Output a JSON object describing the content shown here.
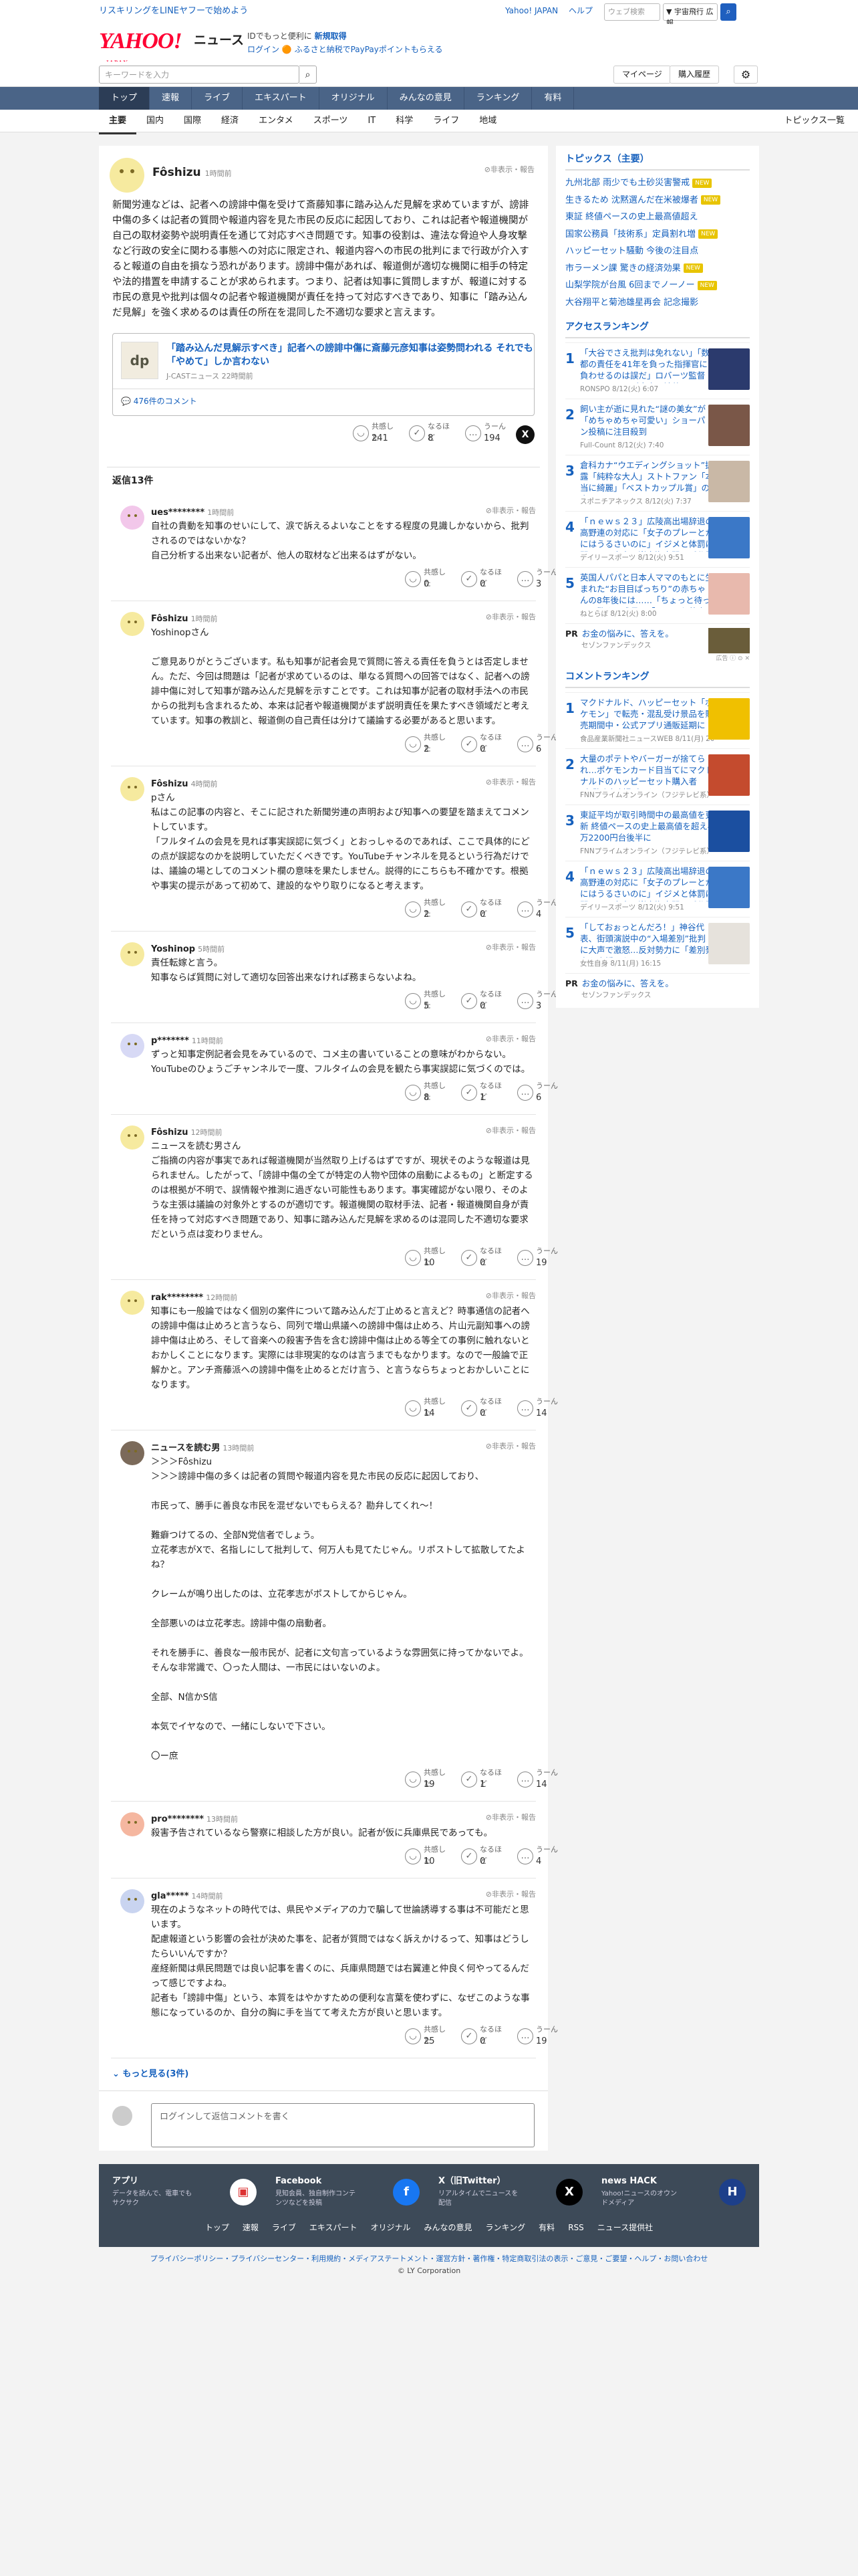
{
  "topbar": {
    "promo": "リスキリングをLINEヤフーで始めよう",
    "links": [
      "Yahoo! JAPAN",
      "ヘルプ"
    ],
    "search_placeholder": "ウェブ検索",
    "select": "▼ 宇宙飛行 広報",
    "search_icon": "search-icon"
  },
  "header": {
    "logo": "YAHOO!",
    "logo_small": "JAPAN",
    "section": "ニュース",
    "promo1_pre": "IDでもっと便利に",
    "promo1_link": "新規取得",
    "promo2": "ログイン 🟠 ふるさと納税でPayPayポイントもらえる"
  },
  "search": {
    "placeholder": "キーワードを入力",
    "mypage": "マイページ",
    "buy": "購入履歴"
  },
  "nav": {
    "tabs": [
      "トップ",
      "速報",
      "ライブ",
      "エキスパート",
      "オリジナル",
      "みんなの意見",
      "ランキング",
      "有料"
    ]
  },
  "categories": {
    "items": [
      "主要",
      "国内",
      "国際",
      "経済",
      "エンタメ",
      "スポーツ",
      "IT",
      "科学",
      "ライフ",
      "地域"
    ],
    "topics_link": "トピックス一覧"
  },
  "post": {
    "name": "Fôshizu",
    "time": "1時間前",
    "report": "非表示・報告",
    "body": "新聞労連などは、記者への謗誹中傷を受けて斎藤知事に踏み込んだ見解を求めていますが、謗誹中傷の多くは記者の質問や報道内容を見た市民の反応に起因しており、これは記者や報道機関が自己の取材姿勢や説明責任を通じて対応すべき問題です。知事の役割は、違法な脅迫や人身攻撃など行政の安全に関わる事態への対応に限定され、報道内容への市民の批判にまで行政が介入すると報道の自由を損なう恐れがあります。謗誹中傷があれば、報道側が適切な機関に相手の特定や法的措置を申請することが求められます。つまり、記者は知事に質問しますが、報道に対する市民の意見や批判は個々の記者や報道機関が責任を持って対応すべきであり、知事に「踏み込んだ見解」を強く求めるのは責任の所在を混同した不適切な要求と言えます。",
    "card": {
      "thumb": "dp",
      "title": "「踏み込んだ見解示すべき」記者への謗誹中傷に斎藤元彦知事は姿勢問われる それでも「やめて」しか言わない",
      "source": "J-CASTニュース 22時間前",
      "comments": "476件のコメント"
    },
    "reactions": [
      {
        "label": "共感した",
        "count": "241"
      },
      {
        "label": "なるほど",
        "count": "8"
      },
      {
        "label": "うーん",
        "count": "194"
      }
    ]
  },
  "reply_header": "返信13件",
  "comments": [
    {
      "name": "ues********",
      "time": "1時間前",
      "avatar": "#f2c7ea",
      "body": "自社の貴動を知事のせいにして、涙で訴えるよいなことをする程度の見識しかないから、批判されるのではないかな？\n自己分析する出来ない記者が、他人の取材など出来るはずがない。",
      "r": [
        "0",
        "0",
        "3"
      ]
    },
    {
      "name": "Fôshizu",
      "time": "1時間前",
      "avatar": "#f6ea9f",
      "body": "Yoshinopさん\n\nご意見ありがとうございます。私も知事が記者会見で質問に答える責任を負うとは否定しません。ただ、今回は問題は「記者が求めているのは、単なる質問への回答ではなく、記者への謗誹中傷に対して知事が踏み込んだ見解を示すことです。これは知事が記者の取材手法への市民からの批判も含まれるため、本来は記者や報道機関がまず説明責任を果たすべき領域だと考えています。知事の教訓と、報道側の自己責任は分けて議論する必要があると思います。",
      "r": [
        "2",
        "0",
        "6"
      ]
    },
    {
      "name": "Fôshizu",
      "time": "4時間前",
      "avatar": "#f6ea9f",
      "body": "pさん\n私はこの記事の内容と、そこに記された新聞労連の声明および知事への要望を踏まえてコメントしています。\n「フルタイムの会見を見れば事実誤認に気づく」とおっしゃるのであれば、ここで具体的にどの点が誤認なのかを説明していただくべきです。YouTubeチャンネルを見るという行為だけでは、議論の場としてのコメント欄の意味を果たしません。説得的にこちらも不確かです。根拠や事実の提示があって初めて、建設的なやり取りになると考えます。",
      "r": [
        "2",
        "0",
        "4"
      ]
    },
    {
      "name": "Yoshinop",
      "time": "5時間前",
      "avatar": "#f6ea9f",
      "body": "責任転嫁と言う。\n知事ならば質問に対して適切な回答出来なければ務まらないよね。",
      "r": [
        "5",
        "0",
        "3"
      ]
    },
    {
      "name": "p*******",
      "time": "11時間前",
      "avatar": "#d7d9f5",
      "body": "ずっと知事定例記者会見をみているので、コメ主の書いていることの意味がわからない。YouTubeのひょうごチャンネルで一度、フルタイムの会見を観たら事実誤認に気づくのでは。",
      "r": [
        "8",
        "1",
        "6"
      ]
    },
    {
      "name": "Fôshizu",
      "time": "12時間前",
      "avatar": "#f6ea9f",
      "body": "ニュースを読む男さん\nご指摘の内容が事実であれば報道機関が当然取り上げるはずですが、現状そのような報道は見られません。したがって、「謗誹中傷の全てが特定の人物や団体の扇動によるもの」と断定するのは根拠が不明で、誤情報や推測に過ぎない可能性もあります。事実確認がない限り、そのような主張は議論の対象外とするのが適切です。報道機関の取材手法、記者・報道機関自身が責任を持って対応すべき問題であり、知事に踏み込んだ見解を求めるのは混同した不適切な要求だという点は変わりません。",
      "r": [
        "10",
        "0",
        "19"
      ]
    },
    {
      "name": "rak********",
      "time": "12時間前",
      "avatar": "#f6ea9f",
      "body": "知事にも一般論ではなく個別の案件について踏み込んだ丁止めると言えど？時事通信の記者への謗誹中傷は止めろと言うなら、同列で増山県議への謗誹中傷は止めろ、片山元副知事への謗誹中傷は止めろ、そして音楽への殺害予告を含む謗誹中傷は止める等全ての事例に触れないとおかしくことになります。実際には非現実的なのは言うまでもなかります。なので一般論で正解かと。アンチ斎藤派への謗誹中傷を止めるとだけ言う、と言うならちょっとおかしいことになります。",
      "r": [
        "14",
        "0",
        "14"
      ]
    },
    {
      "name": "ニュースを読む男",
      "time": "13時間前",
      "avatar": "#7b6a5a",
      "body": "＞＞＞Fôshizu\n＞＞＞謗誹中傷の多くは記者の質問や報道内容を見た市民の反応に起因しており、\n\n市民って、勝手に善良な市民を混ぜないでもらえる？勘弁してくれ〜！\n\n難癖つけてるの、全部N党信者でしょう。\n立花孝志がXで、名指しにして批判して、何万人も見てたじゃん。リポストして拡散してたよね？\n\nクレームが鳴り出したのは、立花孝志がポストしてからじゃん。\n\n全部悪いのは立花孝志。謗誹中傷の扇動者。\n\nそれを勝手に、善良な一般市民が、記者に文句言っているような雰囲気に持ってかないでよ。そんな非常識で、〇った人間は、一市民にはいないのよ。\n\n全部、N信かS信\n\n本気でイヤなので、一緒にしないで下さい。\n\n〇ー庶",
      "r": [
        "19",
        "1",
        "14"
      ]
    },
    {
      "name": "pro********",
      "time": "13時間前",
      "avatar": "#f5b7a0",
      "body": "殺害予告されているなら警察に相談した方が良い。記者が仮に兵庫県民であっても。",
      "r": [
        "10",
        "0",
        "4"
      ]
    },
    {
      "name": "gla*****",
      "time": "14時間前",
      "avatar": "#c9d4f0",
      "body": "現在のようなネットの時代では、県民やメディアの力で騙して世論誘導する事は不可能だと思います。\n配慮報道という影響の会社が決めた事を、記者が質問ではなく訴えかけるって、知事はどうしたらいいんですか？\n産経新聞は県民問題では良い記事を書くのに、兵庫県問題では右翼連と仲良く何やってるんだって感じですよね。\n記者も「謗誹中傷」という、本質をはやかすための便利な言葉を使わずに、なぜこのような事態になっているのか、自分の胸に手を当てて考えた方が良いと思います。",
      "r": [
        "25",
        "0",
        "19"
      ]
    }
  ],
  "more": "もっと見る(3件)",
  "reply_input_placeholder": "ログインして返信コメントを書く",
  "sidebar": {
    "topics_title": "トピックス（主要）",
    "topics": [
      {
        "text": "九州北部 雨少でも土砂災害警戒",
        "badge": "NEW"
      },
      {
        "text": "生きるため 沈黙選んだ在米被爆者",
        "badge": "NEW"
      },
      {
        "text": "東証 終値ペースの史上最高値超え",
        "badge": ""
      },
      {
        "text": "国家公務員「技術系」定員割れ増",
        "badge": "NEW"
      },
      {
        "text": "ハッピーセット騒動 今後の注目点",
        "badge": ""
      },
      {
        "text": "市ラーメン課 驚きの経済効果",
        "badge": "NEW"
      },
      {
        "text": "山梨学院が台風 6回までノーノー",
        "badge": "NEW"
      },
      {
        "text": "大谷翔平と菊池雄星再会 記念撮影",
        "badge": ""
      }
    ],
    "access_title": "アクセスランキング",
    "access": [
      {
        "text": "「大谷でさえ批判は免れない」「数都の責任を41年を負った指揮官に負わせるのは誤だ」ロバーツ監督の“ふるまい”が全米で波紋",
        "src": "RONSPO 8/12(火) 6:07",
        "img": "#2b3a6d"
      },
      {
        "text": "飼い主が逝に見れた“謎の美女”が「めちゃめちゃ可愛い」ショーパン投稿に注目殺到",
        "src": "Full-Count 8/12(火) 7:40",
        "img": "#7a5748"
      },
      {
        "text": "倉科カナ“ウエディングショット”披露「純粋な大人」ストトファン「本当に綺麗」「ベストカップル賞」の声",
        "src": "スポニチアネックス 8/12(火) 7:37",
        "img": "#c9b8a6"
      },
      {
        "text": "「ｎｅｗｓ２３」広陵高出場辞退の高野連の対応に「女子のプレーとかにはうるさいのに」イジメと体罰に関しては寛容」峯大海南開明が私見",
        "src": "デイリースポーツ 8/12(火) 9:51",
        "img": "#3b78c7"
      },
      {
        "text": "英国人パパと日本人ママのもとに生まれた“お目目ぱっちり”の赤ちゃんの8年後には……「ちょっと待って」驚きの成長に「リアルお茶魔」",
        "src": "ねとらぼ 8/12(火) 8:00",
        "img": "#e8b9ad"
      }
    ],
    "pr": {
      "tag": "PR",
      "title": "お金の悩みに、答えを。",
      "src": "セゾンファンデックス",
      "info": "広告 ⓘ ⊙ ✕"
    },
    "comment_title": "コメントランキング",
    "comment_rank": [
      {
        "text": "マクドナルド、ハッピーセット「ポケモン」で転売・混乱受け景品を販売期間中・公式アプリ通販延期に",
        "src": "食品産業新聞社ニュースWEB 8/11(月) 20:38",
        "img": "#f0c000"
      },
      {
        "text": "大量のポテトやバーガーが捨てられ…ポケモンカード目当てにマクドナルドのハッピーセット購入者が“路上無料配布”も",
        "src": "FNNプライムオンライン（フジテレビ系） 8/11(月) 18:21",
        "img": "#c44b2e"
      },
      {
        "text": "東証平均が取引時間中の最高値を更新 終値ペースの史上最高値を超え4万2200円台後半に",
        "src": "FNNプライムオンライン（フジテレビ系） 8/12(火) 9:06",
        "img": "#1b4fa0"
      },
      {
        "text": "「ｎｅｗｓ２３」広陵高出場辞退の高野連の対応に「女子のプレーとかにはうるさいのに」イジメと体罰に関しては寛容」峯大海南開明が私見",
        "src": "デイリースポーツ 8/12(火) 9:51",
        "img": "#3b78c7"
      },
      {
        "text": "「しておぉっとんだろ！」神谷代表、街頭演説中の“入場差別”批判に大声で激怒…反対勢力に「差別発言を応援しないといけないとまたい」",
        "src": "女性自身 8/11(月) 16:15",
        "img": "#e6e2dc"
      }
    ]
  },
  "footer": {
    "cols": [
      {
        "title": "アプリ",
        "desc": "データを読んで、電車でもサクサク",
        "icon": "app-icon",
        "glyph": "▣",
        "color": "#ffffff",
        "fg": "#d33"
      },
      {
        "title": "Facebook",
        "desc": "見知会員、独自制作コンテンツなどを投稿",
        "icon": "facebook-icon",
        "glyph": "f",
        "color": "#1877f2",
        "fg": "#fff"
      },
      {
        "title": "X（旧Twitter）",
        "desc": "リアルタイムでニュースを配信",
        "icon": "x-icon",
        "glyph": "X",
        "color": "#000000",
        "fg": "#fff"
      },
      {
        "title": "news HACK",
        "desc": "Yahoo!ニュースのオウンドメディア",
        "icon": "news-hack-icon",
        "glyph": "H",
        "color": "#1d3f8a",
        "fg": "#fff"
      }
    ],
    "links": [
      "トップ",
      "速報",
      "ライブ",
      "エキスパート",
      "オリジナル",
      "みんなの意見",
      "ランキング",
      "有料",
      "RSS",
      "ニュース提供社"
    ],
    "legal": "プライバシーポリシー・プライバシーセンター・利用規約・メディアステートメント・運営方針・著作権・特定商取引法の表示・ご意見・ご要望・ヘルプ・お問い合わせ",
    "copyright": "© LY Corporation"
  }
}
